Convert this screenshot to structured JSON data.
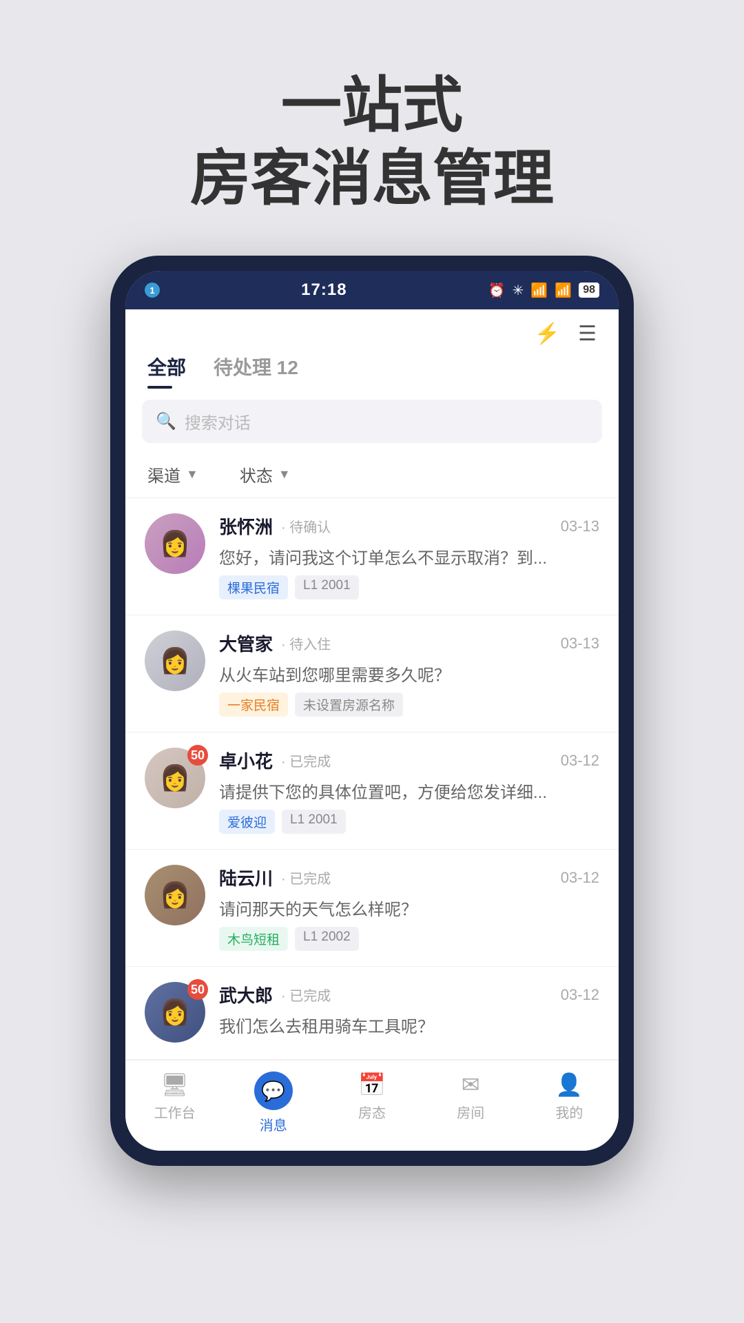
{
  "hero": {
    "line1": "一站式",
    "line2": "房客消息管理"
  },
  "status_bar": {
    "indicator": "1",
    "time": "17:18",
    "battery": "98"
  },
  "header": {
    "tabs": [
      {
        "label": "全部",
        "active": true
      },
      {
        "label": "待处理 12",
        "active": false
      }
    ],
    "search_placeholder": "搜索对话",
    "filters": [
      {
        "label": "渠道"
      },
      {
        "label": "状态"
      }
    ]
  },
  "conversations": [
    {
      "name": "张怀洲",
      "status": "· 待确认",
      "date": "03-13",
      "preview": "您好，请问我这个订单怎么不显示取消？到...",
      "tags": [
        "棵果民宿",
        "L1 2001"
      ],
      "tag_types": [
        "blue",
        "gray"
      ],
      "badge": null,
      "avatar_class": "avatar-img-1"
    },
    {
      "name": "大管家",
      "status": "· 待入住",
      "date": "03-13",
      "preview": "从火车站到您哪里需要多久呢？",
      "tags": [
        "一家民宿",
        "未设置房源名称"
      ],
      "tag_types": [
        "orange",
        "gray"
      ],
      "badge": null,
      "avatar_class": "avatar-img-2"
    },
    {
      "name": "卓小花",
      "status": "· 已完成",
      "date": "03-12",
      "preview": "请提供下您的具体位置吧，方便给您发详细...",
      "tags": [
        "爱彼迎",
        "L1 2001"
      ],
      "tag_types": [
        "blue",
        "gray"
      ],
      "badge": "50",
      "avatar_class": "avatar-img-3"
    },
    {
      "name": "陆云川",
      "status": "· 已完成",
      "date": "03-12",
      "preview": "请问那天的天气怎么样呢？",
      "tags": [
        "木鸟短租",
        "L1 2002"
      ],
      "tag_types": [
        "green",
        "gray"
      ],
      "badge": null,
      "avatar_class": "avatar-img-4"
    },
    {
      "name": "武大郎",
      "status": "· 已完成",
      "date": "03-12",
      "preview": "我们怎么去租用骑车工具呢？",
      "tags": [],
      "tag_types": [],
      "badge": "50",
      "avatar_class": "avatar-img-5"
    }
  ],
  "bottom_nav": [
    {
      "label": "工作台",
      "icon": "🖥",
      "active": false
    },
    {
      "label": "消息",
      "icon": "💬",
      "active": true
    },
    {
      "label": "房态",
      "icon": "📅",
      "active": false
    },
    {
      "label": "房间",
      "icon": "✉",
      "active": false
    },
    {
      "label": "我的",
      "icon": "👤",
      "active": false
    }
  ]
}
